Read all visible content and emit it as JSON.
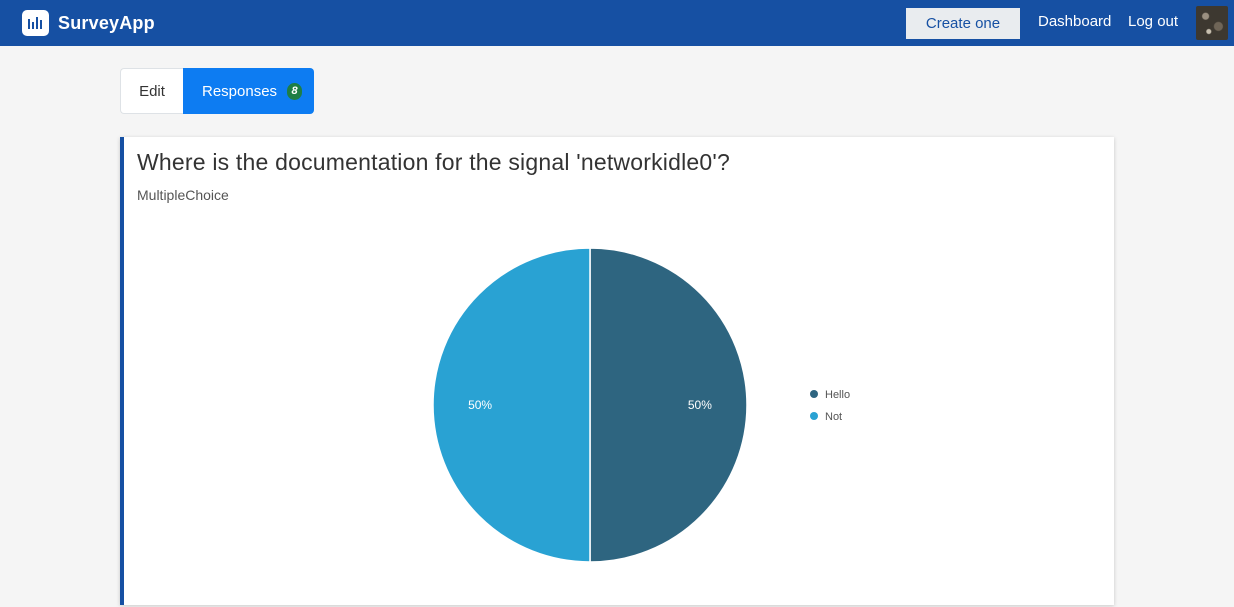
{
  "navbar": {
    "brand": "SurveyApp",
    "create_label": "Create one",
    "dashboard_label": "Dashboard",
    "logout_label": "Log out",
    "color": "#1650a3"
  },
  "tabs": {
    "edit_label": "Edit",
    "responses_label": "Responses",
    "responses_count": "8"
  },
  "question": {
    "title": "Where is the documentation for the signal 'networkidle0'?",
    "type": "MultipleChoice"
  },
  "chart_data": {
    "type": "pie",
    "categories": [
      "Hello",
      "Not"
    ],
    "values": [
      50,
      50
    ],
    "labels": [
      "50%",
      "50%"
    ],
    "colors": [
      "#2e6580",
      "#29a2d3"
    ],
    "legend_position": "right"
  }
}
